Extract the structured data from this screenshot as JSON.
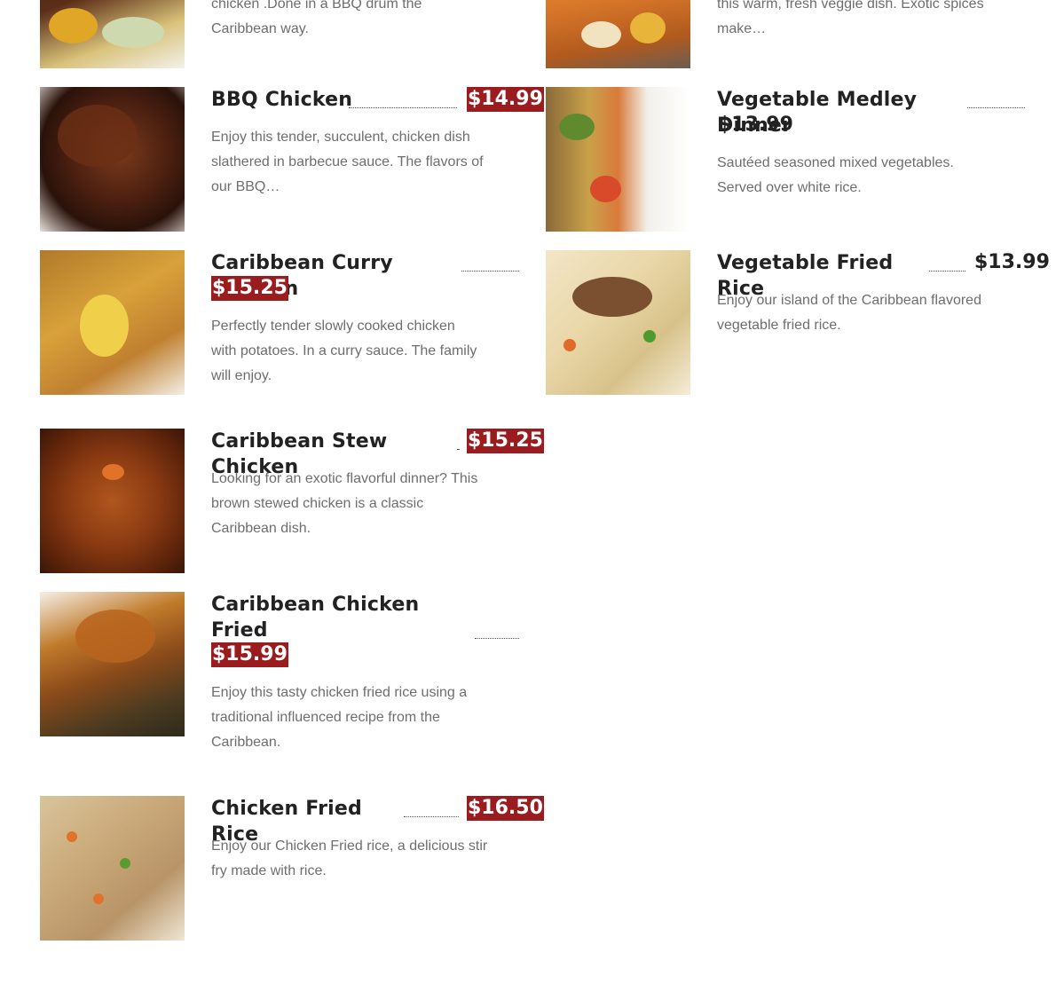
{
  "partial_top": {
    "left_desc": [
      "chicken .Done in a BBQ drum the",
      "Caribbean way."
    ],
    "right_desc": [
      "this warm, fresh veggie dish. Exotic spices",
      "make…"
    ]
  },
  "menu": [
    {
      "title_lines": [
        "BBQ Chicken"
      ],
      "price": "$14.99",
      "price_style": "highlight",
      "desc_lines": [
        "Enjoy this tender, succulent, chicken dish",
        "slathered in barbecue sauce. The flavors of",
        "our BBQ…"
      ],
      "image_icon": "bbq-chicken-photo"
    },
    {
      "title_lines": [
        "Vegetable Medley Dinner"
      ],
      "price": "$13.99",
      "price_style": "plain",
      "desc_lines": [
        "Sautéed seasoned mixed vegetables.",
        "Served over white rice."
      ],
      "image_icon": "vegetable-medley-photo"
    },
    {
      "title_lines": [
        "Caribbean Curry Chicken"
      ],
      "price": "$15.25",
      "price_style": "highlight",
      "desc_lines": [
        "Perfectly tender slowly cooked chicken",
        "with potatoes. In a curry sauce. The family",
        "will enjoy."
      ],
      "image_icon": "curry-chicken-photo"
    },
    {
      "title_lines": [
        "Vegetable Fried Rice"
      ],
      "price": "$13.99",
      "price_style": "plain",
      "desc_lines": [
        "Enjoy our island of the Caribbean flavored",
        "vegetable fried rice."
      ],
      "image_icon": "vegetable-fried-rice-photo"
    },
    {
      "title_lines": [
        "Caribbean Stew Chicken"
      ],
      "price": "$15.25",
      "price_style": "highlight",
      "desc_lines": [
        "Looking for an exotic flavorful dinner? This",
        "brown stewed chicken is a classic",
        "Caribbean dish."
      ],
      "image_icon": "stew-chicken-photo"
    },
    {
      "title_lines": [
        "Caribbean Chicken Fried",
        "Rice"
      ],
      "price": "$15.99",
      "price_style": "highlight",
      "desc_lines": [
        "Enjoy this tasty chicken fried rice using a",
        "traditional influenced recipe from the",
        "Caribbean."
      ],
      "image_icon": "chicken-fried-rice-caribbean-photo"
    },
    {
      "title_lines": [
        "Chicken Fried Rice"
      ],
      "price": "$16.50",
      "price_style": "highlight",
      "desc_lines": [
        "Enjoy our Chicken Fried rice, a delicious stir",
        "fry made with rice."
      ],
      "image_icon": "chicken-fried-rice-photo"
    }
  ],
  "colors": {
    "price_highlight_bg": "#9b1c1f",
    "title": "#222222",
    "description": "#6e6e6e"
  }
}
